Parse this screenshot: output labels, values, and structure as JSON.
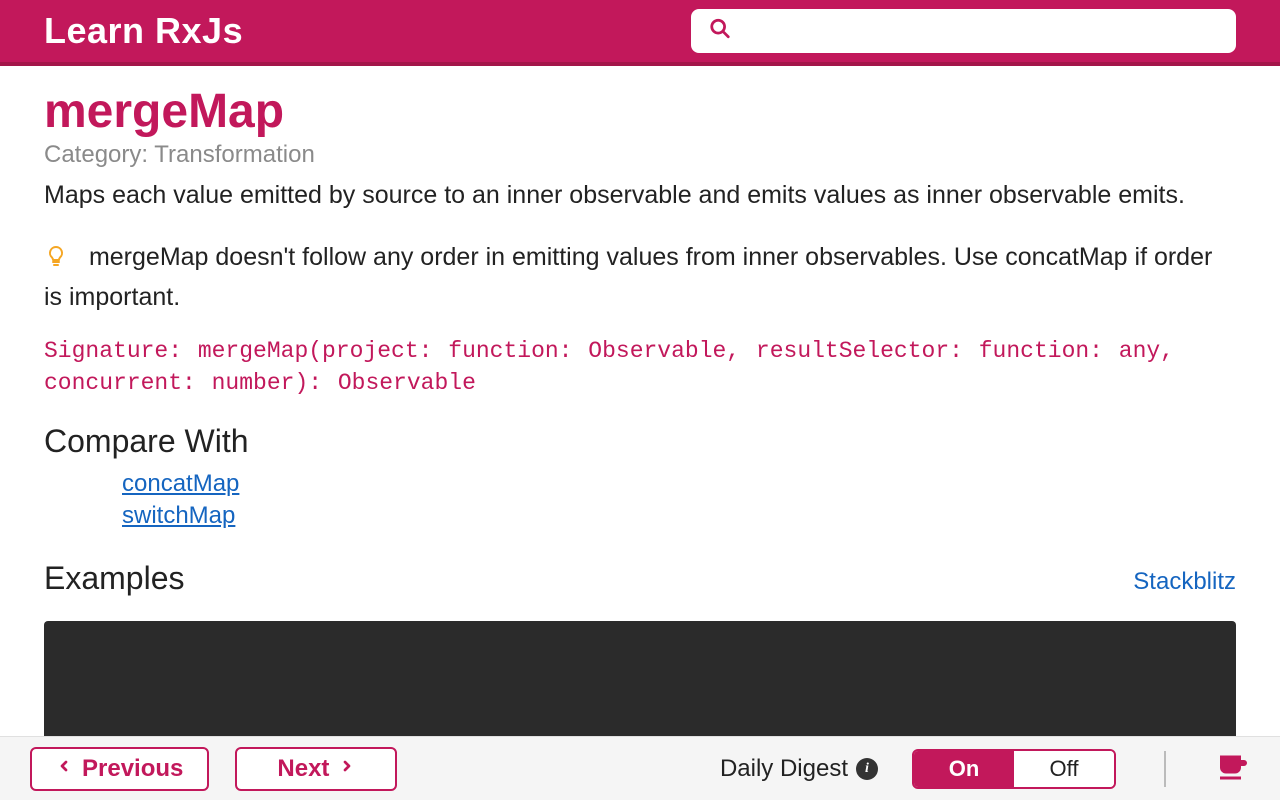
{
  "header": {
    "brand": "Learn RxJs",
    "search_placeholder": ""
  },
  "page": {
    "title": "mergeMap",
    "category_label": "Category: Transformation",
    "description": "Maps each value emitted by source to an inner observable and emits values as inner observable emits.",
    "tip": "mergeMap doesn't follow any order in emitting values from inner observables. Use concatMap if order is important.",
    "signature": "Signature: mergeMap(project: function: Observable, resultSelector: function: any, concurrent: number): Observable",
    "compare_heading": "Compare With",
    "compare_links": [
      "concatMap",
      "switchMap"
    ],
    "examples_heading": "Examples",
    "stackblitz_label": "Stackblitz"
  },
  "footer": {
    "prev_label": "Previous",
    "next_label": "Next",
    "digest_label": "Daily Digest",
    "toggle_on": "On",
    "toggle_off": "Off"
  }
}
